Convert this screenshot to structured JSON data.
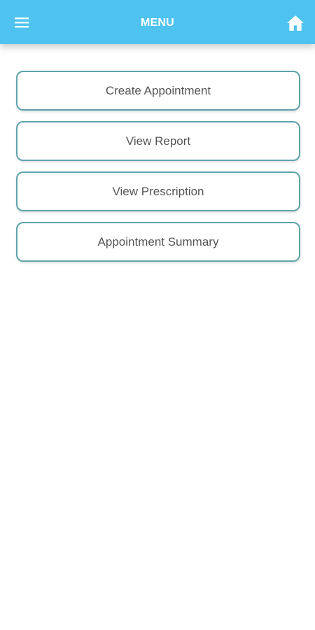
{
  "header": {
    "title": "MENU",
    "menu_icon": "hamburger-menu-icon",
    "home_icon": "home-icon",
    "background_color": "#4fc3ef"
  },
  "menu": {
    "items": [
      {
        "label": "Create Appointment"
      },
      {
        "label": "View Report"
      },
      {
        "label": "View Prescription"
      },
      {
        "label": "Appointment Summary"
      }
    ],
    "border_color": "#5fa3ab",
    "text_color": "#555555"
  }
}
